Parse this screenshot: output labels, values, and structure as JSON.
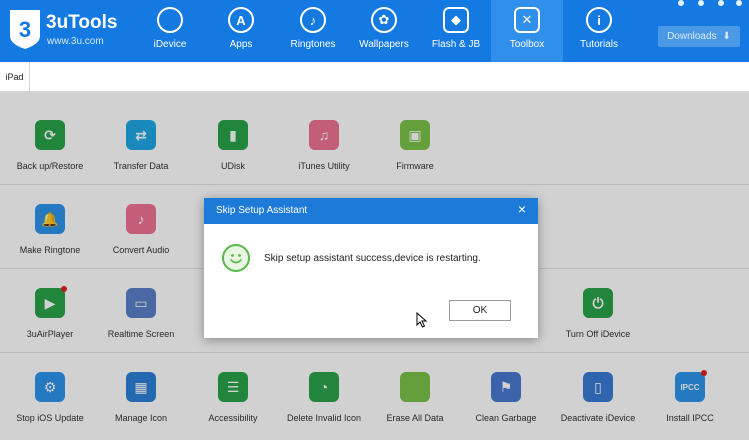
{
  "app": {
    "name": "3uTools",
    "url": "www.3u.com"
  },
  "nav": [
    {
      "label": "iDevice",
      "icon": "apple-icon",
      "glyph": ""
    },
    {
      "label": "Apps",
      "icon": "app-store-icon",
      "glyph": "A"
    },
    {
      "label": "Ringtones",
      "icon": "bell-icon",
      "glyph": "♪"
    },
    {
      "label": "Wallpapers",
      "icon": "flower-icon",
      "glyph": "✿"
    },
    {
      "label": "Flash & JB",
      "icon": "dropbox-icon",
      "glyph": "◆"
    },
    {
      "label": "Toolbox",
      "icon": "tools-icon",
      "glyph": "✕"
    },
    {
      "label": "Tutorials",
      "icon": "info-icon",
      "glyph": "i"
    }
  ],
  "downloads": {
    "label": "Downloads",
    "glyph": "⬇"
  },
  "tab": {
    "label": "iPad"
  },
  "tools": [
    {
      "label": "Back up/Restore",
      "color": "#2aa34a",
      "glyph": "⟳"
    },
    {
      "label": "Transfer Data",
      "color": "#1fa8e6",
      "glyph": "⇄"
    },
    {
      "label": "UDisk",
      "color": "#2aa34a",
      "glyph": "▮"
    },
    {
      "label": "iTunes Utility",
      "color": "#f07292",
      "glyph": "♫"
    },
    {
      "label": "Firmware",
      "color": "#7cc24a",
      "glyph": "▣"
    },
    {
      "label": "Make Ringtone",
      "color": "#2c94ec",
      "glyph": "🔔"
    },
    {
      "label": "Convert Audio",
      "color": "#f07292",
      "glyph": "♪"
    },
    {
      "label": "3uAirPlayer",
      "color": "#2aa34a",
      "glyph": "▶"
    },
    {
      "label": "Realtime Screen",
      "color": "#5a7fc9",
      "glyph": "▭"
    },
    {
      "label": "Turn Off iDevice",
      "color": "#2aa34a",
      "glyph": "⏻"
    },
    {
      "label": "Stop iOS Update",
      "color": "#2c94ec",
      "glyph": "⚙"
    },
    {
      "label": "Manage Icon",
      "color": "#2c7fd6",
      "glyph": "▦"
    },
    {
      "label": "Accessibility",
      "color": "#2aa34a",
      "glyph": "☰"
    },
    {
      "label": "Delete Invalid Icon",
      "color": "#2aa34a",
      "glyph": "◔"
    },
    {
      "label": "Erase All Data",
      "color": "#7cc24a",
      "glyph": ""
    },
    {
      "label": "Clean Garbage",
      "color": "#4a78d0",
      "glyph": "⚑"
    },
    {
      "label": "Deactivate iDevice",
      "color": "#3a7ad6",
      "glyph": "▯"
    },
    {
      "label": "Install IPCC",
      "color": "#2c94ec",
      "glyph": "IPCC"
    }
  ],
  "dialog": {
    "title": "Skip Setup Assistant",
    "message": "Skip setup assistant success,device is restarting.",
    "ok_label": "OK",
    "close_glyph": "×"
  }
}
